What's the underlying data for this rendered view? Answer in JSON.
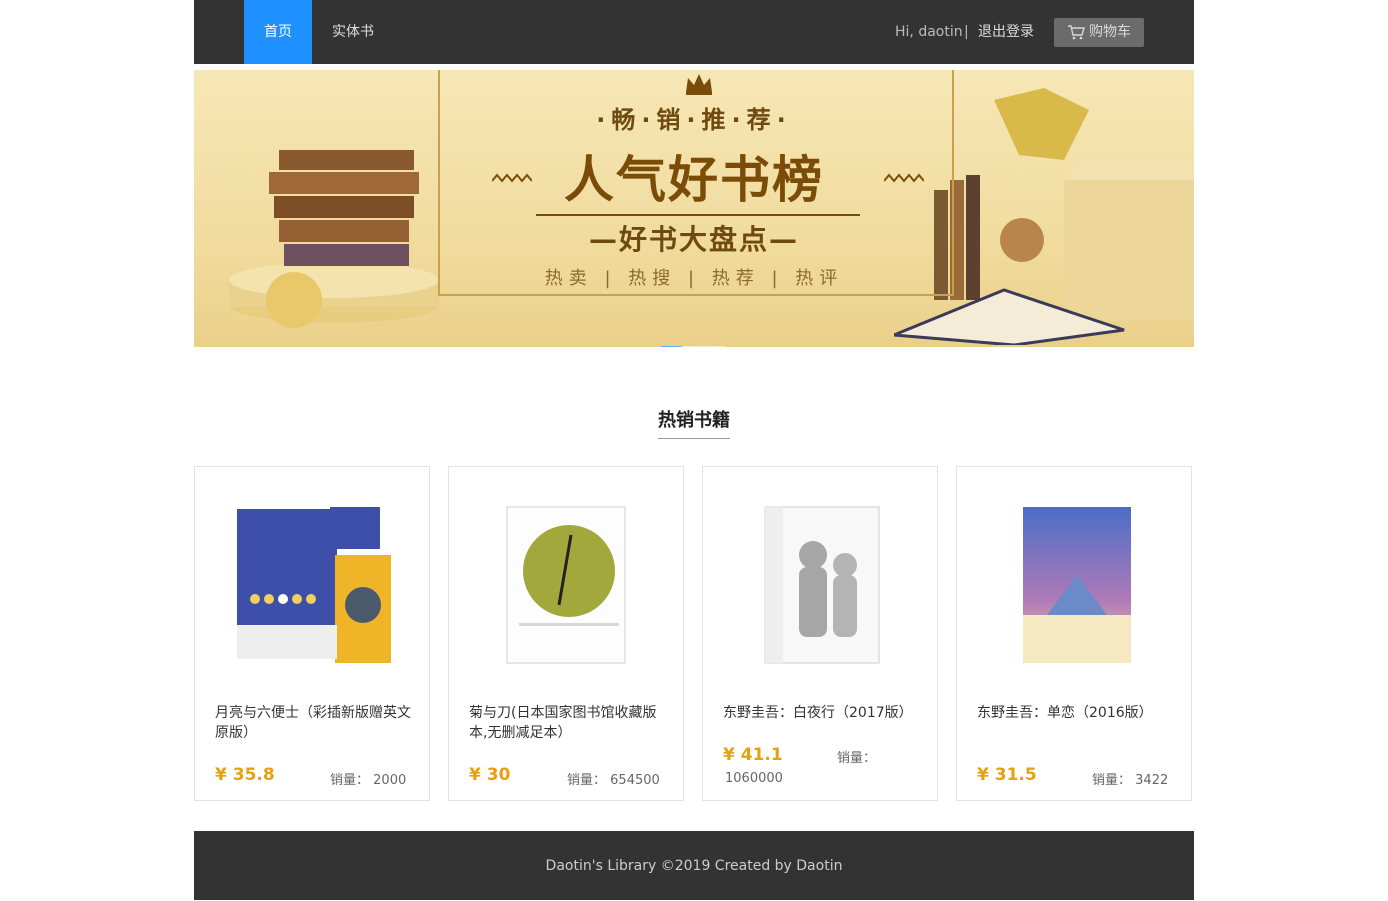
{
  "nav": {
    "home": "首页",
    "books": "实体书",
    "greeting": "Hi, daotin",
    "separator": "|",
    "logout": "退出登录",
    "cart": "购物车"
  },
  "banner": {
    "line1": "·畅·销·推·荐·",
    "line2": "人气好书榜",
    "line3": "—好书大盘点—",
    "line4": "热卖 | 热搜 | 热荐 | 热评"
  },
  "section_title": "热销书籍",
  "books": [
    {
      "name": "月亮与六便士（彩插新版赠英文原版）",
      "price": "¥ 35.8",
      "sales_label": "销量：",
      "sales": "2000"
    },
    {
      "name": "菊与刀(日本国家图书馆收藏版本,无删减足本）",
      "price": "¥ 30",
      "sales_label": "销量：",
      "sales": "654500"
    },
    {
      "name": "东野圭吾：白夜行（2017版）",
      "price": "¥ 41.1",
      "sales_label": "销量：",
      "sales": "1060000"
    },
    {
      "name": "东野圭吾：单恋（2016版）",
      "price": "¥ 31.5",
      "sales_label": "销量：",
      "sales": "3422"
    }
  ],
  "footer": "Daotin's Library ©2019 Created by Daotin"
}
